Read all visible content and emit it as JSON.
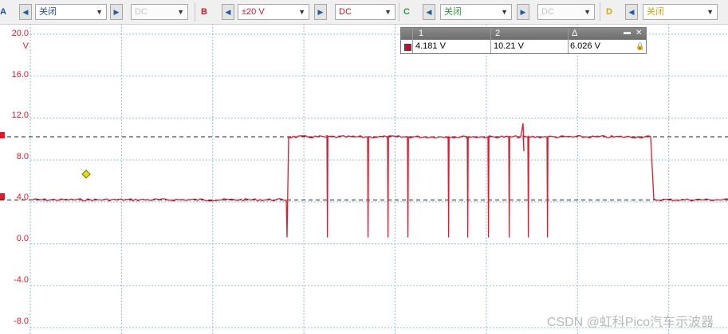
{
  "toolbar": {
    "channels": [
      {
        "letter": "A",
        "color": "#1f4fa0",
        "range": "关闭",
        "coupling": "DC",
        "coupling_dim": true
      },
      {
        "letter": "B",
        "color": "#d0152b",
        "range": "±20 V",
        "coupling": "DC",
        "coupling_dim": false
      },
      {
        "letter": "C",
        "color": "#2a9a37",
        "range": "关闭",
        "coupling": "DC",
        "coupling_dim": true
      },
      {
        "letter": "D",
        "color": "#d8a600",
        "range": "关闭",
        "coupling": "",
        "coupling_dim": true
      }
    ],
    "prev_icon": "◀",
    "next_icon": "▶",
    "dropdown_icon": "▼"
  },
  "axis": {
    "ticks": [
      "20.0",
      "16.0",
      "12.0",
      "8.0",
      "4.0",
      "0.0",
      "-4.0",
      "-8.0"
    ],
    "unit": "V"
  },
  "measurement": {
    "headers": [
      "1",
      "2",
      "Δ"
    ],
    "values": [
      "4.181 V",
      "10.21 V",
      "6.026 V"
    ],
    "minimize": "▬",
    "close": "✕",
    "lock": "🔒"
  },
  "watermark": "CSDN @虹科Pico汽车示波器",
  "chart_data": {
    "type": "line",
    "ylabel": "V",
    "ylim": [
      -8,
      20
    ],
    "yticks": [
      20,
      16,
      12,
      8,
      4,
      0,
      -4,
      -8
    ],
    "series": [
      {
        "color": "#e0192d",
        "low_level": 4.2,
        "high_level": 10.2,
        "drop_level": 0.6
      }
    ],
    "cursors": [
      4.181,
      10.21
    ],
    "delta": 6.026,
    "grid": true
  }
}
